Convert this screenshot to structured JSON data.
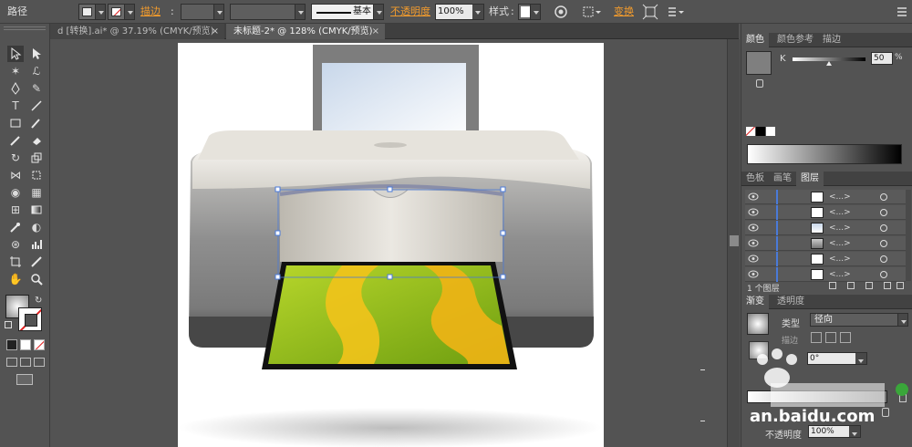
{
  "control_bar": {
    "object_type": "路径",
    "stroke_label": "描边",
    "stroke_style": "基本",
    "opacity_label": "不透明度",
    "opacity_value": "100%",
    "style_label": "样式",
    "transform_label": "变换"
  },
  "tabs": [
    {
      "label": "d [转换].ai* @ 37.19% (CMYK/预览)",
      "close": "×"
    },
    {
      "label": "未标题-2* @ 128% (CMYK/预览)",
      "close": "×"
    }
  ],
  "color_panel": {
    "tabs": [
      "颜色",
      "颜色参考",
      "描边"
    ],
    "channel_label": "K",
    "channel_value": "50",
    "channel_unit": "%",
    "k_level": 0.5
  },
  "layers_panel": {
    "tabs": [
      "色板",
      "画笔",
      "图层"
    ],
    "rows": [
      {
        "name": "<...>"
      },
      {
        "name": "<...>"
      },
      {
        "name": "<...>"
      },
      {
        "name": "<...>"
      },
      {
        "name": "<...>"
      },
      {
        "name": "<...>"
      }
    ],
    "layer_count": "1 个图层"
  },
  "gradient_panel": {
    "tabs": [
      "渐变",
      "透明度"
    ],
    "type_label": "类型",
    "type_value": "径向",
    "stroke_label": "描边",
    "angle_value": "0°",
    "opacity_label": "不透明度",
    "opacity_value": "100%"
  },
  "watermark": {
    "text": "an.baidu.com"
  },
  "colors": {
    "ui_bg": "#535353",
    "accent_orange": "#f39c2d",
    "selection_blue": "#4a7ad8",
    "printer_body": "#d8d6d1",
    "photo_green": "#8cbf1a",
    "photo_yellow": "#f2c31b"
  }
}
